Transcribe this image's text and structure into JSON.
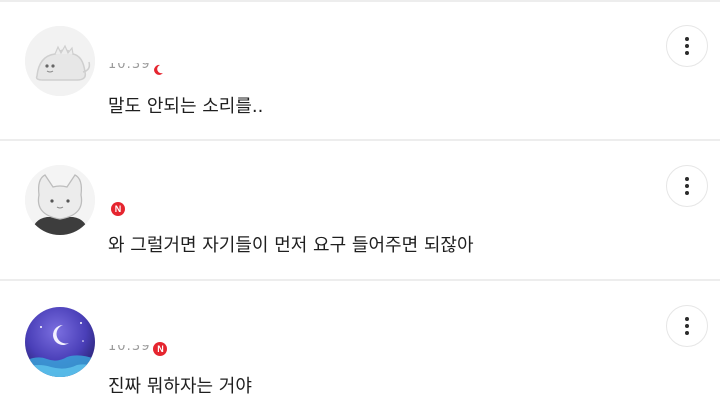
{
  "comments": [
    {
      "avatar_icon": "dinosaur-avatar-icon",
      "time": "10:39",
      "badge_icon": "red-crescent-icon",
      "text": "말도 안되는 소리를.."
    },
    {
      "avatar_icon": "cat-avatar-icon",
      "time": "",
      "badge": "N",
      "text": "와 그럴거면 자기들이 먼저 요구 들어주면 되잖아"
    },
    {
      "avatar_icon": "moon-night-avatar-icon",
      "time": "10:39",
      "badge": "N",
      "text": "진짜 뭐하자는 거야"
    }
  ],
  "more_icon": "kebab-menu-icon",
  "colors": {
    "badge_red": "#e5252f",
    "divider": "#ededed",
    "text": "#1f1f1f"
  }
}
